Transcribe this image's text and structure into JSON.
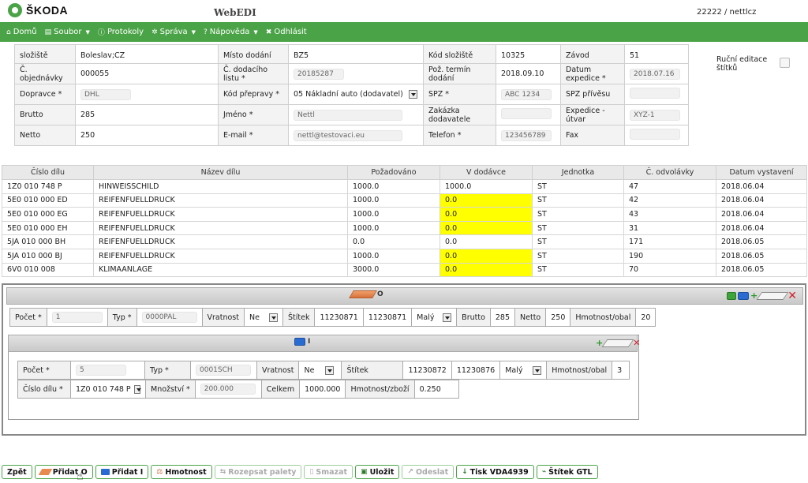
{
  "header": {
    "logo_text": "ŠKODA",
    "app_title": "WebEDI",
    "user": "22222 / nettlcz"
  },
  "menu": [
    {
      "icon": "⌂",
      "label": "Domů",
      "caret": ""
    },
    {
      "icon": "▤",
      "label": "Soubor",
      "caret": "▼"
    },
    {
      "icon": "ⓘ",
      "label": "Protokoly",
      "caret": ""
    },
    {
      "icon": "✲",
      "label": "Správa",
      "caret": "▼"
    },
    {
      "icon": "?",
      "label": "Nápověda",
      "caret": "▼"
    },
    {
      "icon": "✖",
      "label": "Odhlásit",
      "caret": ""
    }
  ],
  "form": {
    "r0": {
      "l1": "složiště",
      "v1": "Boleslav;CZ",
      "l2": "Místo dodání",
      "v2": "BZ5",
      "l3": "Kód složiště",
      "v3": "10325",
      "l4": "Závod",
      "v4": "51"
    },
    "r1": {
      "l1": "Č. objednávky",
      "v1": "000055",
      "l2": "Č. dodacího listu *",
      "v2": "20185287",
      "l3": "Pož. termín dodání",
      "v3": "2018.09.10",
      "l4": "Datum expedice *",
      "v4": "2018.07.16"
    },
    "r2": {
      "l1": "Dopravce *",
      "v1": "DHL",
      "l2": "Kód přepravy *",
      "v2": "05 Nákladní auto (dodavatel)",
      "l3": "SPZ *",
      "v3": "ABC 1234",
      "l4": "SPZ přívěsu",
      "v4": ""
    },
    "r3": {
      "l1": "Brutto",
      "v1": "285",
      "l2": "Jméno *",
      "v2": "Nettl",
      "l3": "Zakázka dodavatele",
      "v3": "",
      "l4": "Expedice - útvar",
      "v4": "XYZ-1"
    },
    "r4": {
      "l1": "Netto",
      "v1": "250",
      "l2": "E-mail *",
      "v2": "nettl@testovaci.eu",
      "l3": "Telefon *",
      "v3": "123456789",
      "l4": "Fax",
      "v4": ""
    },
    "manual_label": "Ruční editace štítků"
  },
  "parts": {
    "columns": [
      "Číslo dílu",
      "Název dílu",
      "Požadováno",
      "V dodávce",
      "Jednotka",
      "Č. odvolávky",
      "Datum vystavení"
    ],
    "rows": [
      [
        "1Z0 010 748 P",
        "HINWEISSCHILD",
        "1000.0",
        "1000.0",
        "ST",
        "47",
        "2018.06.04"
      ],
      [
        "5E0 010 000 ED",
        "REIFENFUELLDRUCK",
        "1000.0",
        "0.0",
        "ST",
        "42",
        "2018.06.04"
      ],
      [
        "5E0 010 000 EG",
        "REIFENFUELLDRUCK",
        "1000.0",
        "0.0",
        "ST",
        "43",
        "2018.06.04"
      ],
      [
        "5E0 010 000 EH",
        "REIFENFUELLDRUCK",
        "1000.0",
        "0.0",
        "ST",
        "31",
        "2018.06.04"
      ],
      [
        "5JA 010 000 BH",
        "REIFENFUELLDRUCK",
        "0.0",
        "0.0",
        "ST",
        "171",
        "2018.06.05"
      ],
      [
        "5JA 010 000 BJ",
        "REIFENFUELLDRUCK",
        "1000.0",
        "0.0",
        "ST",
        "190",
        "2018.06.05"
      ],
      [
        "6V0 010 008",
        "KLIMAANLAGE",
        "3000.0",
        "0.0",
        "ST",
        "70",
        "2018.06.05"
      ]
    ],
    "highlight_color": "#ffff00"
  },
  "pallet": {
    "title": "O",
    "count_label": "Počet *",
    "count": "1",
    "type_label": "Typ *",
    "type": "0000PAL",
    "return_label": "Vratnost",
    "return": "Ne",
    "label_label": "Štítek",
    "label_from": "11230871",
    "label_to": "11230871",
    "size": "Malý",
    "brutto_label": "Brutto",
    "brutto": "285",
    "netto_label": "Netto",
    "netto": "250",
    "weight_label": "Hmotnost/obal",
    "weight": "20"
  },
  "box": {
    "title": "I",
    "count_label": "Počet *",
    "count": "5",
    "type_label": "Typ *",
    "type": "0001SCH",
    "return_label": "Vratnost",
    "return": "Ne",
    "label_label": "Štítek",
    "label_from": "11230872",
    "label_to": "11230876",
    "size": "Malý",
    "weight_label": "Hmotnost/obal",
    "weight": "3",
    "part_label": "Číslo dílu *",
    "part": "1Z0 010 748 P",
    "qty_label": "Množství *",
    "qty": "200.000",
    "total_label": "Celkem",
    "total": "1000.000",
    "wpi_label": "Hmotnost/zboží",
    "wpi": "0.250"
  },
  "buttons": {
    "back": "Zpět",
    "add_o": "Přidat O",
    "add_i": "Přidat I",
    "weight": "Hmotnost",
    "split": "Rozepsat palety",
    "delete": "Smazat",
    "save": "Uložit",
    "send": "Odeslat",
    "print": "Tisk VDA4939",
    "label": "Štítek GTL"
  },
  "colors": {
    "brand_green": "#4aa347",
    "highlight": "#ffff00"
  }
}
